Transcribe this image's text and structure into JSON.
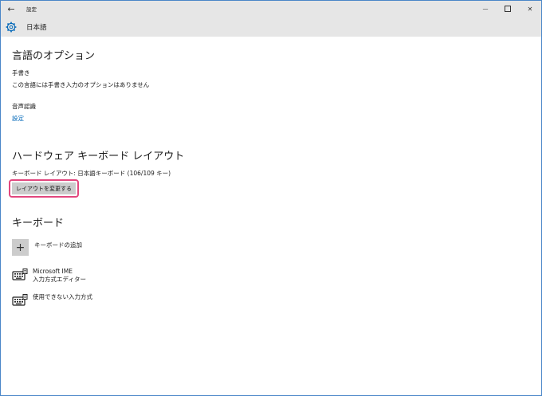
{
  "titlebar": {
    "back_glyph": "←",
    "title": "設定",
    "minimize_glyph": "—",
    "close_glyph": "✕"
  },
  "header": {
    "title": "日本語"
  },
  "language_options": {
    "title": "言語のオプション",
    "handwriting_label": "手書き",
    "handwriting_text": "この言語には手書き入力のオプションはありません",
    "speech_label": "音声認識",
    "speech_link": "設定"
  },
  "hardware_keyboard": {
    "title": "ハードウェア キーボード レイアウト",
    "layout_text": "キーボード レイアウト: 日本語キーボード (106/109 キー)",
    "change_button": "レイアウトを変更する"
  },
  "keyboard": {
    "title": "キーボード",
    "add_label": "キーボードの追加",
    "plus_glyph": "+",
    "items": [
      {
        "name": "Microsoft IME",
        "sub": "入力方式エディター"
      },
      {
        "name": "使用できない入力方式",
        "sub": ""
      }
    ]
  },
  "icons": [
    "back-arrow-icon",
    "gear-icon",
    "plus-icon",
    "keyboard-icon"
  ],
  "colors": {
    "accent_link": "#0067b8",
    "highlight_border": "#e2477e",
    "chrome": "#e6e6e6",
    "window_border": "#4a86c8"
  }
}
